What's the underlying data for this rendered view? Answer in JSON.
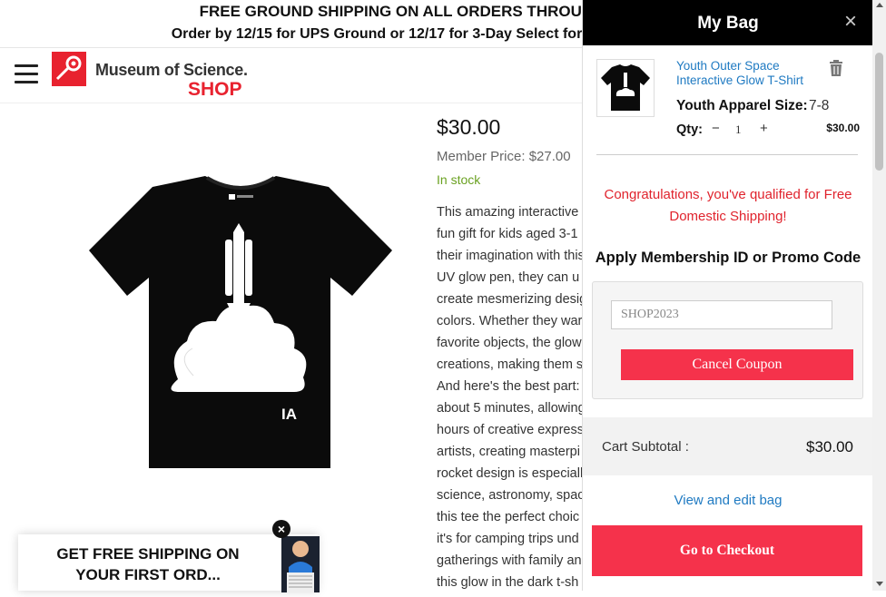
{
  "banner": {
    "line1": "FREE GROUND SHIPPING ON ALL ORDERS THROUGH",
    "line2": "Order by 12/15 for UPS Ground or 12/17 for 3-Day Select for"
  },
  "header": {
    "logo_name": "Museum of Science.",
    "logo_shop": "SHOP"
  },
  "product": {
    "price": "$30.00",
    "member_price": "Member Price: $27.00",
    "stock": "In stock",
    "description_lines": [
      "This amazing interactive g",
      "fun gift for kids aged 3-1",
      "their imagination with this",
      "UV glow pen, they can u",
      "create mesmerizing desig",
      "colors. Whether they war",
      "favorite objects, the glow",
      "creations, making them s",
      "And here's the best part:",
      "about 5 minutes, allowing",
      "hours of creative express",
      "artists, creating masterpi",
      "rocket design is especiall",
      "science, astronomy, spac",
      "this tee the perfect choic",
      "it's for camping trips und",
      "gatherings with family an",
      "this glow in the dark t-sh"
    ],
    "shirt_mark": "IA"
  },
  "promo_popup": {
    "text": "GET FREE SHIPPING ON YOUR FIRST ORD...",
    "close": "×"
  },
  "bag": {
    "title": "My Bag",
    "close": "×",
    "item": {
      "name": "Youth Outer Space Interactive Glow T-Shirt",
      "size_label": "Youth Apparel Size:",
      "size_value": "7-8",
      "qty_label": "Qty:",
      "qty_minus": "−",
      "qty_value": "1",
      "qty_plus": "+",
      "price": "$30.00"
    },
    "congrats": "Congratulations, you've qualified for Free Domestic Shipping!",
    "promo_title": "Apply Membership ID or Promo Code",
    "promo_code": "SHOP2023",
    "cancel_coupon": "Cancel Coupon",
    "subtotal_label": "Cart Subtotal :",
    "subtotal_value": "$30.00",
    "view_edit": "View and edit bag",
    "checkout": "Go to Checkout"
  },
  "colors": {
    "accent": "#f5324b",
    "brand_red": "#e8222f",
    "link": "#1f7ac2",
    "stock_green": "#6aa121"
  }
}
